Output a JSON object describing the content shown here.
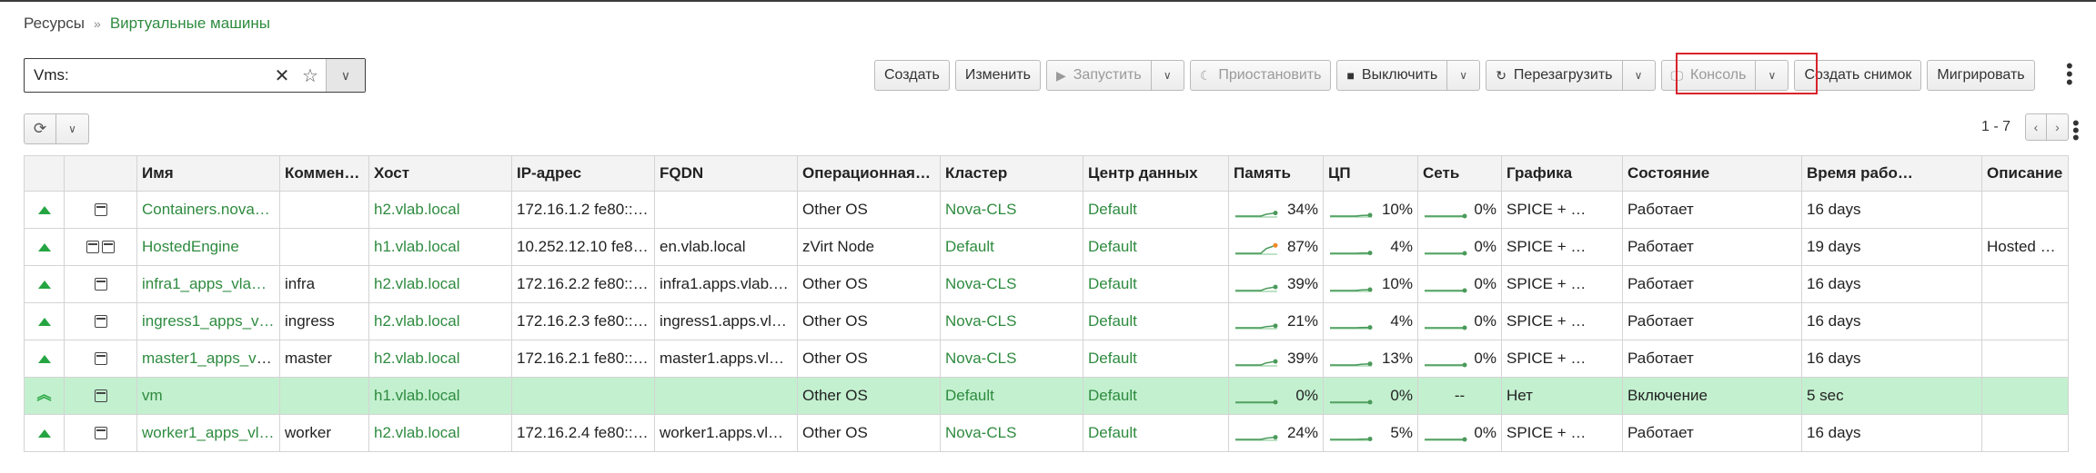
{
  "breadcrumb": {
    "root": "Ресурсы",
    "separator": "»",
    "current": "Виртуальные машины"
  },
  "search": {
    "value": "Vms:",
    "placeholder": ""
  },
  "toolbar": {
    "create": "Создать",
    "edit": "Изменить",
    "run": "Запустить",
    "suspend": "Приостановить",
    "shutdown": "Выключить",
    "reboot": "Перезагрузить",
    "console": "Консоль",
    "snapshot": "Создать снимок",
    "migrate": "Мигрировать"
  },
  "pager": {
    "range": "1 - 7"
  },
  "columns": [
    "Имя",
    "Коммен…",
    "Хост",
    "IP-адрес",
    "FQDN",
    "Операционная…",
    "Кластер",
    "Центр данных",
    "Память",
    "ЦП",
    "Сеть",
    "Графика",
    "Состояние",
    "Время рабо…",
    "Описание"
  ],
  "rows": [
    {
      "status": "up",
      "icons": 1,
      "name": "Containers.nova…",
      "comment": "",
      "host": "h2.vlab.local",
      "ip": "172.16.1.2 fe80::…",
      "fqdn": "",
      "os": "Other OS",
      "cluster": "Nova-CLS",
      "dc": "Default",
      "mem": "34%",
      "cpu": "10%",
      "net": "0%",
      "graphics": "SPICE + …",
      "state": "Работает",
      "uptime": "16 days",
      "desc": ""
    },
    {
      "status": "up",
      "icons": 2,
      "name": "HostedEngine",
      "comment": "",
      "host": "h1.vlab.local",
      "ip": "10.252.12.10 fe8…",
      "fqdn": "en.vlab.local",
      "os": "zVirt Node",
      "cluster": "Default",
      "dc": "Default",
      "mem": "87%",
      "cpu": "4%",
      "net": "0%",
      "graphics": "SPICE + …",
      "state": "Работает",
      "uptime": "19 days",
      "desc": "Hosted engine VM"
    },
    {
      "status": "up",
      "icons": 1,
      "name": "infra1_apps_vla…",
      "comment": "infra",
      "host": "h2.vlab.local",
      "ip": "172.16.2.2 fe80::…",
      "fqdn": "infra1.apps.vlab.…",
      "os": "Other OS",
      "cluster": "Nova-CLS",
      "dc": "Default",
      "mem": "39%",
      "cpu": "10%",
      "net": "0%",
      "graphics": "SPICE + …",
      "state": "Работает",
      "uptime": "16 days",
      "desc": ""
    },
    {
      "status": "up",
      "icons": 1,
      "name": "ingress1_apps_v…",
      "comment": "ingress",
      "host": "h2.vlab.local",
      "ip": "172.16.2.3 fe80::…",
      "fqdn": "ingress1.apps.vl…",
      "os": "Other OS",
      "cluster": "Nova-CLS",
      "dc": "Default",
      "mem": "21%",
      "cpu": "4%",
      "net": "0%",
      "graphics": "SPICE + …",
      "state": "Работает",
      "uptime": "16 days",
      "desc": ""
    },
    {
      "status": "up",
      "icons": 1,
      "name": "master1_apps_vl…",
      "comment": "master",
      "host": "h2.vlab.local",
      "ip": "172.16.2.1 fe80::…",
      "fqdn": "master1.apps.vl…",
      "os": "Other OS",
      "cluster": "Nova-CLS",
      "dc": "Default",
      "mem": "39%",
      "cpu": "13%",
      "net": "0%",
      "graphics": "SPICE + …",
      "state": "Работает",
      "uptime": "16 days",
      "desc": ""
    },
    {
      "status": "powering-up",
      "icons": 1,
      "name": "vm",
      "comment": "",
      "host": "h1.vlab.local",
      "ip": "",
      "fqdn": "",
      "os": "Other OS",
      "cluster": "Default",
      "dc": "Default",
      "mem": "0%",
      "cpu": "0%",
      "net": "--",
      "graphics": "Нет",
      "state": "Включение",
      "uptime": "5 sec",
      "desc": ""
    },
    {
      "status": "up",
      "icons": 1,
      "name": "worker1_apps_vl…",
      "comment": "worker",
      "host": "h2.vlab.local",
      "ip": "172.16.2.4 fe80::…",
      "fqdn": "worker1.apps.vl…",
      "os": "Other OS",
      "cluster": "Nova-CLS",
      "dc": "Default",
      "mem": "24%",
      "cpu": "5%",
      "net": "0%",
      "graphics": "SPICE + …",
      "state": "Работает",
      "uptime": "16 days",
      "desc": ""
    }
  ],
  "colors": {
    "link": "#2e8b3f",
    "status_up": "#25a542",
    "selected_row": "#c3f0cf",
    "highlight": "#d9232a",
    "spark_high": "#f08a24"
  }
}
